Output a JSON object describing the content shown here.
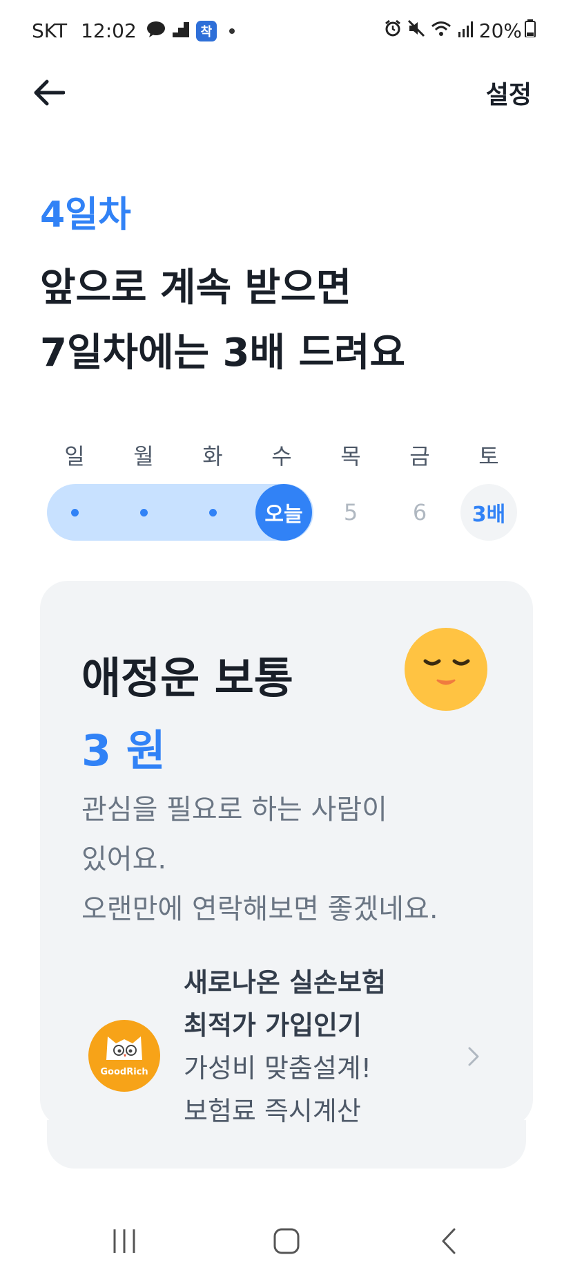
{
  "status_bar": {
    "carrier": "SKT",
    "time": "12:02",
    "app_badge": "착",
    "battery": "20%"
  },
  "header": {
    "settings_label": "설정"
  },
  "progress": {
    "day_label": "4일차",
    "headline_line1": "앞으로 계속 받으면",
    "headline_line2": "7일차에는 3배 드려요"
  },
  "week": {
    "weekdays": [
      "일",
      "월",
      "화",
      "수",
      "목",
      "금",
      "토"
    ],
    "today_label": "오늘",
    "day5": "5",
    "day6": "6",
    "bonus_label": "3배"
  },
  "fortune": {
    "title": "애정운 보통",
    "reward": "3 원",
    "message_line1": "관심을 필요로 하는 사람이",
    "message_line2": "있어요.",
    "message_line3": "오랜만에 연락해보면 좋겠네요.",
    "emoji_icon": "sleepy-face-icon"
  },
  "ad": {
    "title_line1": "새로나온 실손보험",
    "title_line2": "최적가 가입인기",
    "desc_line1": "가성비 맞춤설계!",
    "desc_line2": "보험료 즉시계산",
    "logo_text": "GoodRich"
  },
  "colors": {
    "accent": "#3182f6",
    "track": "#c8e1ff",
    "card": "#f2f4f6",
    "emoji": "#ffc342",
    "ad_logo": "#f7a318"
  }
}
